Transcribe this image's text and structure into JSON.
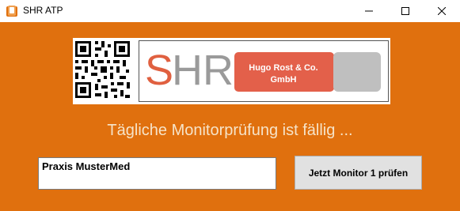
{
  "window": {
    "title": "SHR ATP",
    "icon": "app-icon",
    "controls": [
      "minimize-icon",
      "maximize-icon",
      "close-icon"
    ]
  },
  "logo": {
    "shr_s": "S",
    "shr_hr": "HR",
    "company_line1": "Hugo Rost & Co.",
    "company_line2": "GmbH"
  },
  "notice": "Tägliche Monitorprüfung ist fällig ...",
  "practice_field": {
    "value": "Praxis MusterMed"
  },
  "check_button": {
    "label": "Jetzt Monitor 1 prüfen"
  },
  "colors": {
    "background": "#e0700e",
    "notice_text": "#f6e3c8",
    "shr_s": "#e06040",
    "shr_hr": "#9a9a9a",
    "company_box": "#e3604a",
    "grey_box": "#bfbfbf"
  }
}
